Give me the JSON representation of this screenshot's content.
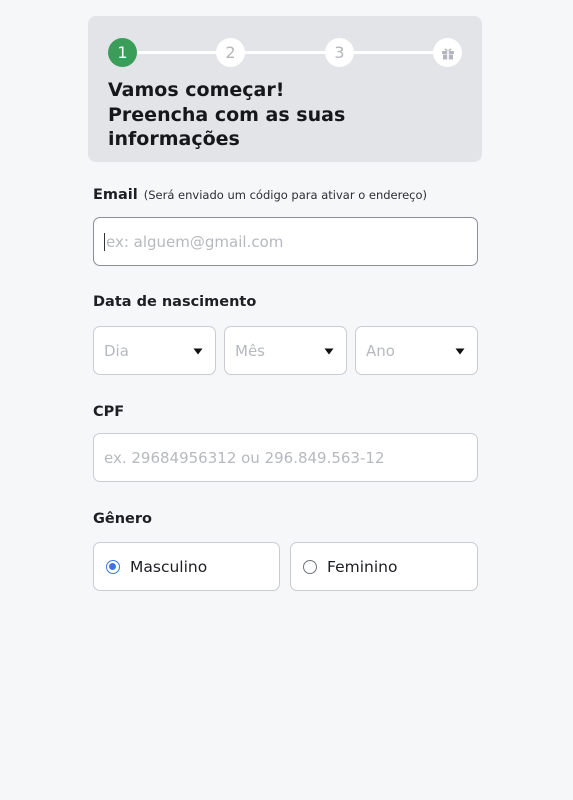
{
  "stepper": {
    "steps": [
      "1",
      "2",
      "3"
    ],
    "active_step": 1,
    "final_icon": "gift-icon"
  },
  "header": {
    "title_line1": "Vamos começar!",
    "title_line2": "Preencha com as suas",
    "title_line3": "informações"
  },
  "email": {
    "label": "Email",
    "hint": "(Será enviado um código para ativar o endereço)",
    "placeholder": "ex: alguem@gmail.com",
    "value": ""
  },
  "birthdate": {
    "label": "Data de nascimento",
    "day_placeholder": "Dia",
    "month_placeholder": "Mês",
    "year_placeholder": "Ano"
  },
  "cpf": {
    "label": "CPF",
    "placeholder": "ex. 29684956312 ou 296.849.563-12",
    "value": ""
  },
  "gender": {
    "label": "Gênero",
    "options": [
      {
        "label": "Masculino",
        "selected": true
      },
      {
        "label": "Feminino",
        "selected": false
      }
    ]
  },
  "colors": {
    "active_step": "#3b9d5a",
    "radio_selected": "#3b76e1",
    "header_bg": "#e2e4e8"
  }
}
